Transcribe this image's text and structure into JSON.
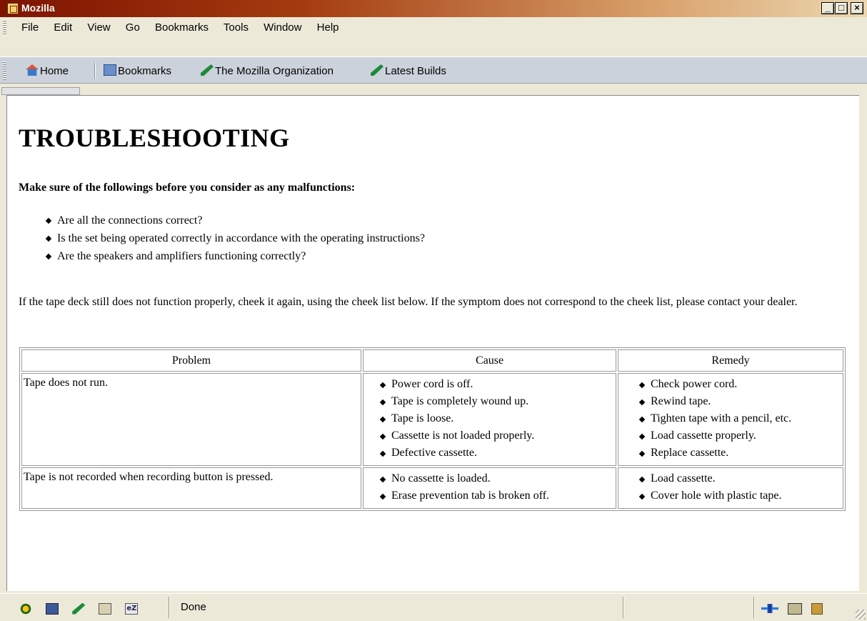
{
  "window": {
    "title": "Mozilla",
    "min_label": "_",
    "max_label": "□",
    "close_label": "×"
  },
  "menu": [
    "File",
    "Edit",
    "View",
    "Go",
    "Bookmarks",
    "Tools",
    "Window",
    "Help"
  ],
  "personal_toolbar": {
    "home": "Home",
    "bookmarks": "Bookmarks",
    "mozilla_org": "The Mozilla Organization",
    "latest_builds": "Latest Builds"
  },
  "page": {
    "heading": "TROUBLESHOOTING",
    "intro": "Make sure of the followings before you consider as any malfunctions:",
    "checks": [
      "Are all the connections correct?",
      "Is the set being operated correctly in accordance with the operating instructions?",
      "Are the speakers and amplifiers functioning correctly?"
    ],
    "paragraph": "If the tape deck still does not function properly, cheek it again, using the cheek list below. If the symptom does not correspond to the cheek list, please contact your dealer.",
    "table": {
      "headers": [
        "Problem",
        "Cause",
        "Remedy"
      ],
      "rows": [
        {
          "problem": "Tape does not run.",
          "causes": [
            "Power cord is off.",
            "Tape is completely wound up.",
            "Tape is loose.",
            "Cassette is not loaded properly.",
            "Defective cassette."
          ],
          "remedies": [
            "Check power cord.",
            "Rewind tape.",
            "Tighten tape with a pencil, etc.",
            "Load cassette properly.",
            "Replace cassette."
          ]
        },
        {
          "problem": "Tape is not recorded when recording button is pressed.",
          "causes": [
            "No cassette is loaded.",
            "Erase prevention tab is broken off."
          ],
          "remedies": [
            "Load cassette.",
            "Cover hole with plastic tape."
          ]
        }
      ]
    }
  },
  "status": {
    "text": "Done",
    "icon5_label": "eZ"
  },
  "icons": {
    "title": "mozilla-logo-icon",
    "home": "home-icon",
    "bookmarks": "bookmarks-folder-icon",
    "link": "pen-link-icon",
    "status_left": [
      "navigator-icon",
      "mail-icon",
      "composer-icon",
      "address-book-icon",
      "chat-icon"
    ],
    "status_right": [
      "online-connection-icon",
      "cookie-icon",
      "security-lock-icon"
    ]
  }
}
